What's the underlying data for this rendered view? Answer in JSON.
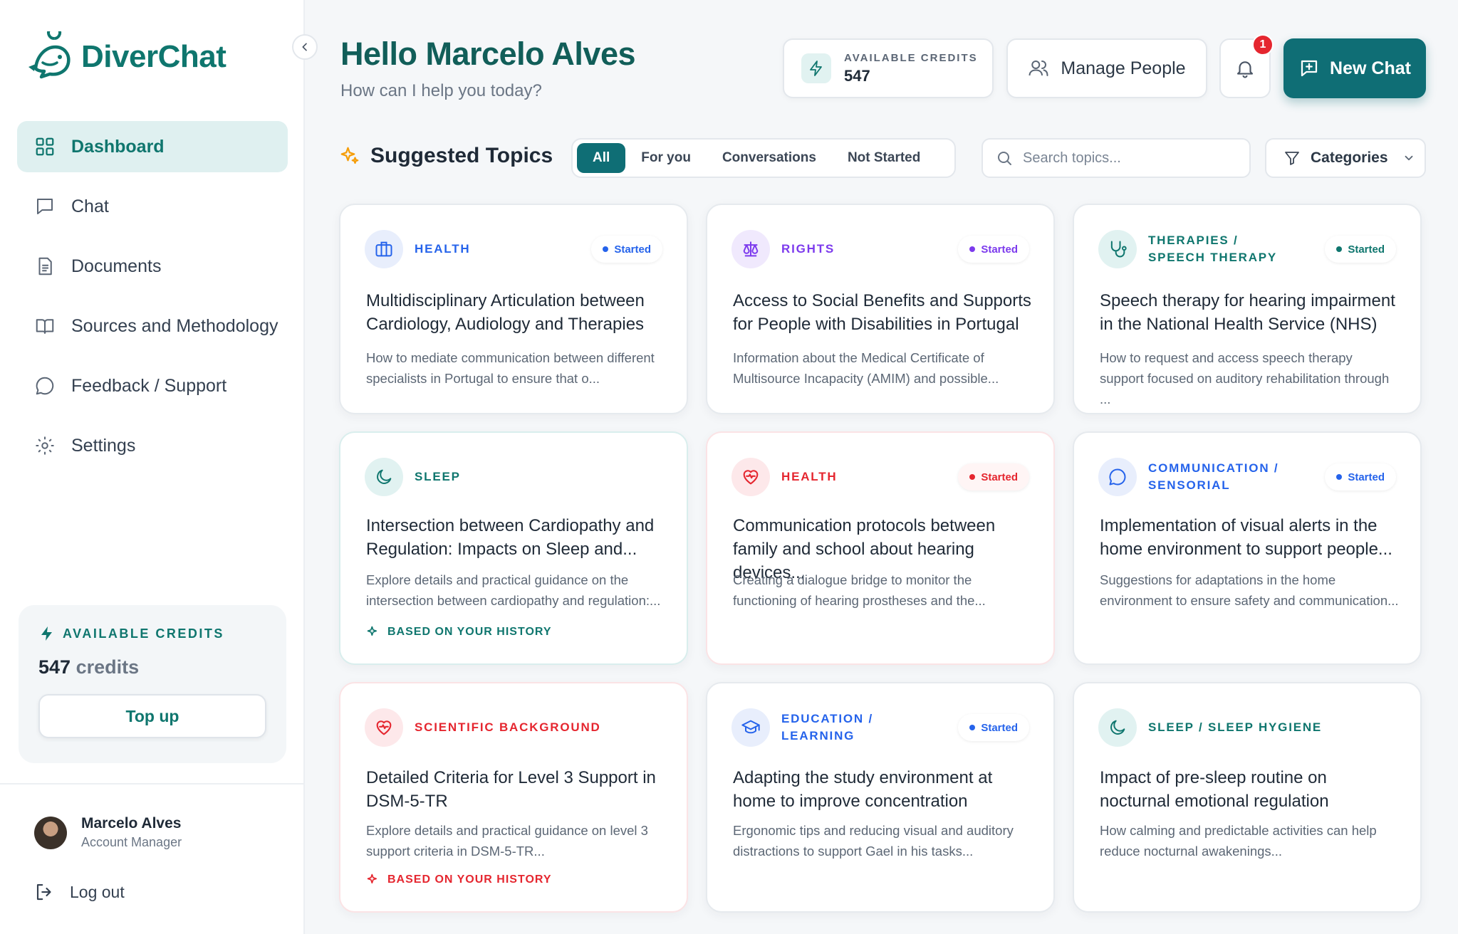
{
  "app": {
    "brand": "DiverChat"
  },
  "sidebar": {
    "items": [
      {
        "label": "Dashboard",
        "icon": "grid-icon",
        "active": true
      },
      {
        "label": "Chat",
        "icon": "chat-icon"
      },
      {
        "label": "Documents",
        "icon": "document-icon"
      },
      {
        "label": "Sources and Methodology",
        "icon": "book-icon"
      },
      {
        "label": "Feedback / Support",
        "icon": "message-circle-icon"
      },
      {
        "label": "Settings",
        "icon": "gear-icon"
      }
    ],
    "credits": {
      "title": "AVAILABLE CREDITS",
      "amount": "547",
      "unit": "credits",
      "topup_label": "Top up"
    },
    "user": {
      "name": "Marcelo Alves",
      "role": "Account Manager"
    },
    "logout_label": "Log out"
  },
  "header": {
    "greeting": "Hello Marcelo Alves",
    "subtitle": "How can I help you today?",
    "credits_label": "AVAILABLE CREDITS",
    "credits_value": "547",
    "manage_label": "Manage People",
    "notification_count": "1",
    "new_chat_label": "New Chat"
  },
  "topics": {
    "title": "Suggested Topics",
    "tabs": [
      "All",
      "For you",
      "Conversations",
      "Not Started"
    ],
    "search_placeholder": "Search topics...",
    "categories_label": "Categories"
  },
  "cards": [
    {
      "category_line1": "HEALTH",
      "category_line2": "",
      "badge": "Started",
      "title": "Multidisciplinary Articulation between Cardiology, Audiology and Therapies",
      "description": "How to mediate communication between different specialists in Portugal to ensure that o...",
      "history": ""
    },
    {
      "category_line1": "RIGHTS",
      "category_line2": "",
      "badge": "Started",
      "title": "Access to Social Benefits and Supports for People with Disabilities in Portugal",
      "description": "Information about the Medical Certificate of Multisource Incapacity (AMIM) and possible...",
      "history": ""
    },
    {
      "category_line1": "THERAPIES /",
      "category_line2": "SPEECH THERAPY",
      "badge": "Started",
      "title": "Speech therapy for hearing impairment in the National Health Service (NHS)",
      "description": "How to request and access speech therapy support focused on auditory rehabilitation through ...",
      "history": ""
    },
    {
      "category_line1": "SLEEP",
      "category_line2": "",
      "badge": "",
      "title": "Intersection between Cardiopathy and Regulation: Impacts on Sleep and...",
      "description": "Explore details and practical guidance on the intersection between cardiopathy and regulation:...",
      "history": "BASED ON YOUR HISTORY"
    },
    {
      "category_line1": "HEALTH",
      "category_line2": "",
      "badge": "Started",
      "title": "Communication protocols between family and school about hearing devices...",
      "description": "Creating a dialogue bridge to monitor the functioning of hearing prostheses and the...",
      "history": ""
    },
    {
      "category_line1": "COMMUNICATION /",
      "category_line2": "SENSORIAL",
      "badge": "Started",
      "title": "Implementation of visual alerts in the home environment to support people...",
      "description": "Suggestions for adaptations in the home environment to ensure safety and communication...",
      "history": ""
    },
    {
      "category_line1": "SCIENTIFIC BACKGROUND",
      "category_line2": "",
      "badge": "",
      "title": "Detailed Criteria for Level 3 Support in DSM-5-TR",
      "description": "Explore details and practical guidance on level 3 support criteria in DSM-5-TR...",
      "history": "BASED ON YOUR HISTORY"
    },
    {
      "category_line1": "EDUCATION /",
      "category_line2": "LEARNING",
      "badge": "Started",
      "title": "Adapting the study environment at home to improve concentration",
      "description": "Ergonomic tips and reducing visual and auditory distractions to support Gael in his tasks...",
      "history": ""
    },
    {
      "category_line1": "SLEEP / SLEEP HYGIENE",
      "category_line2": "",
      "badge": "",
      "title": "Impact of pre-sleep routine on nocturnal emotional regulation",
      "description": "How calming and predictable activities can help reduce nocturnal awakenings...",
      "history": ""
    }
  ],
  "colors": {
    "primary": "#0f6e75",
    "teal": "#0f766e",
    "blue": "#2563eb",
    "purple": "#7c3aed",
    "red": "#e5262f"
  }
}
